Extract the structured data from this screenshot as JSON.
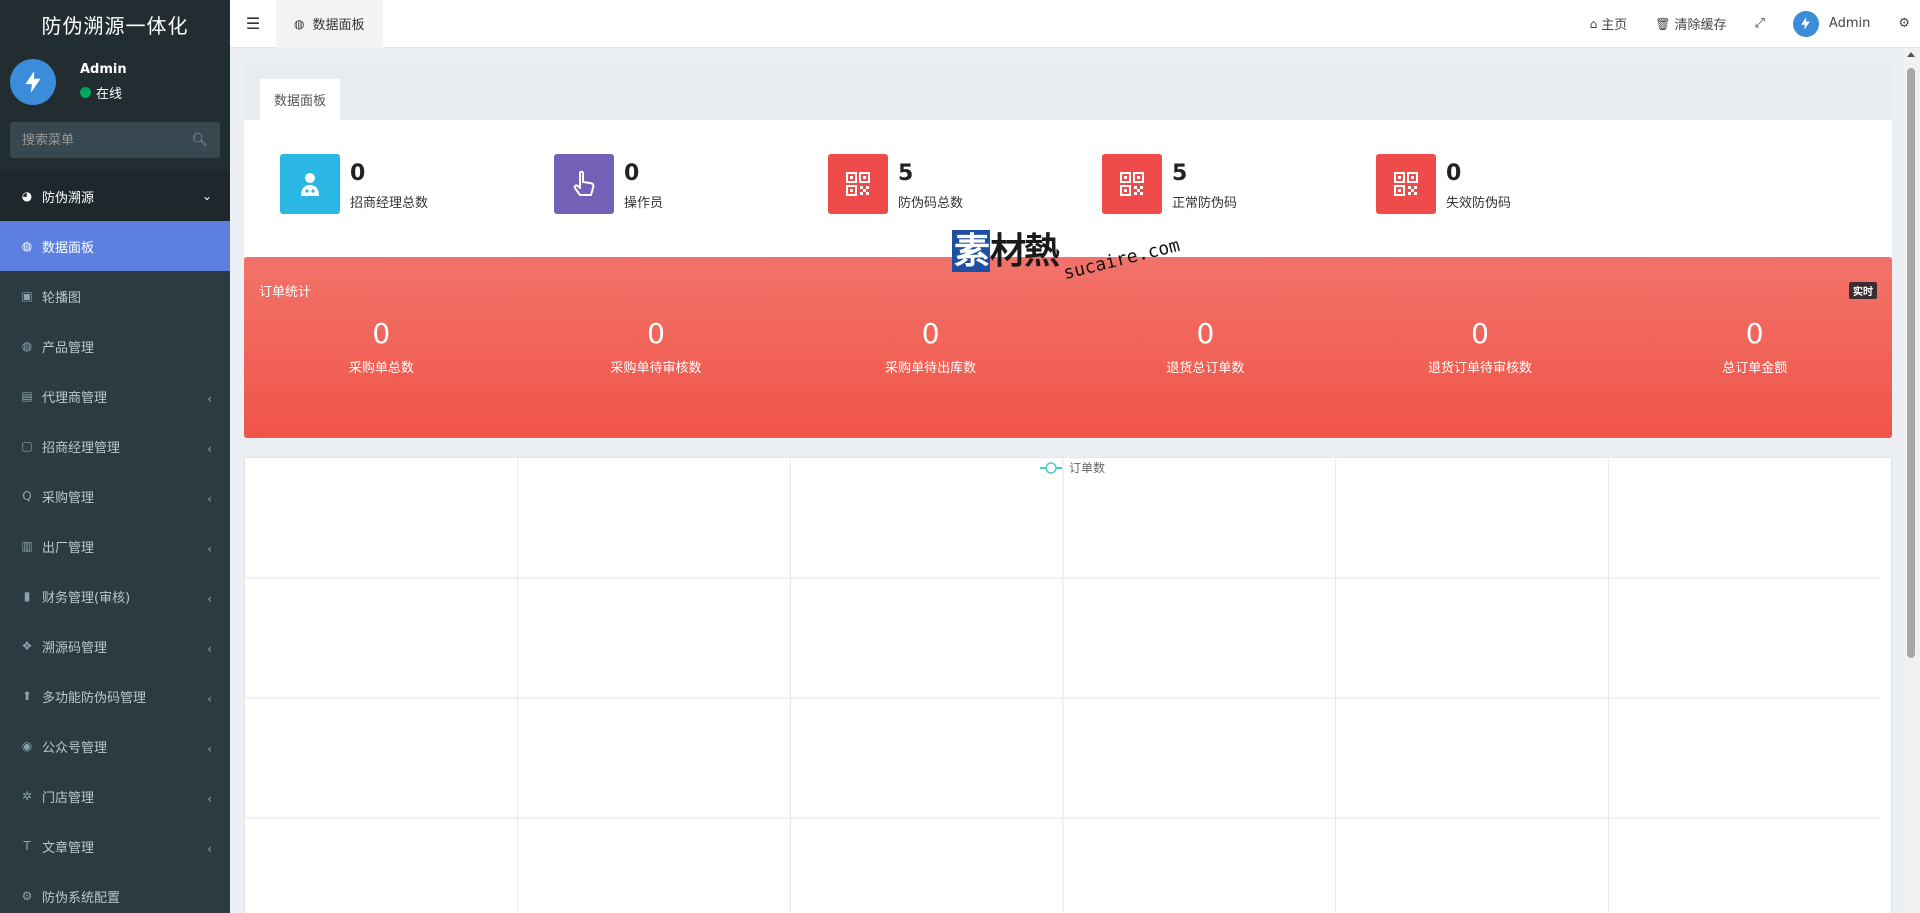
{
  "sidebar": {
    "logo": "防伪溯源一体化",
    "user": {
      "name": "Admin",
      "status": "在线"
    },
    "search_placeholder": "搜索菜单",
    "group": {
      "label": "防伪溯源",
      "icon": "pie-chart-icon"
    },
    "items": [
      {
        "label": "数据面板",
        "icon": "globe-icon",
        "active": true,
        "has_children": false
      },
      {
        "label": "轮播图",
        "icon": "image-icon",
        "active": false,
        "has_children": false
      },
      {
        "label": "产品管理",
        "icon": "globe-icon",
        "active": false,
        "has_children": false
      },
      {
        "label": "代理商管理",
        "icon": "id-card-icon",
        "active": false,
        "has_children": true
      },
      {
        "label": "招商经理管理",
        "icon": "contact-icon",
        "active": false,
        "has_children": true
      },
      {
        "label": "采购管理",
        "icon": "search-q-icon",
        "active": false,
        "has_children": true
      },
      {
        "label": "出厂管理",
        "icon": "truck-icon",
        "active": false,
        "has_children": true
      },
      {
        "label": "财务管理(审核)",
        "icon": "book-icon",
        "active": false,
        "has_children": true
      },
      {
        "label": "溯源码管理",
        "icon": "cubes-icon",
        "active": false,
        "has_children": true
      },
      {
        "label": "多功能防伪码管理",
        "icon": "upload-circle-icon",
        "active": false,
        "has_children": true
      },
      {
        "label": "公众号管理",
        "icon": "wechat-icon",
        "active": false,
        "has_children": true
      },
      {
        "label": "门店管理",
        "icon": "gear-circle-icon",
        "active": false,
        "has_children": true
      },
      {
        "label": "文章管理",
        "icon": "text-icon",
        "active": false,
        "has_children": true
      },
      {
        "label": "防伪系统配置",
        "icon": "gear-icon",
        "active": false,
        "has_children": false
      }
    ]
  },
  "navbar": {
    "tab_label": "数据面板",
    "home": "主页",
    "clear_cache": "清除缓存",
    "user": "Admin"
  },
  "content": {
    "tab_label": "数据面板",
    "stats": [
      {
        "value": "0",
        "label": "招商经理总数",
        "color": "#2ab7e3",
        "icon": "user-doctor-icon"
      },
      {
        "value": "0",
        "label": "操作员",
        "color": "#7460b6",
        "icon": "hand-pointer-icon"
      },
      {
        "value": "5",
        "label": "防伪码总数",
        "color": "#ef4b4b",
        "icon": "qrcode-icon"
      },
      {
        "value": "5",
        "label": "正常防伪码",
        "color": "#ef4b4b",
        "icon": "qrcode-icon"
      },
      {
        "value": "0",
        "label": "失效防伪码",
        "color": "#ef4b4b",
        "icon": "qrcode-icon"
      }
    ],
    "order": {
      "title": "订单统计",
      "badge": "实时",
      "items": [
        {
          "value": "0",
          "label": "采购单总数"
        },
        {
          "value": "0",
          "label": "采购单待审核数"
        },
        {
          "value": "0",
          "label": "采购单待出库数"
        },
        {
          "value": "0",
          "label": "退货总订单数"
        },
        {
          "value": "0",
          "label": "退货订单待审核数"
        },
        {
          "value": "0",
          "label": "总订单金额"
        }
      ]
    },
    "watermark": {
      "main": "素材熱",
      "sub": "sucaire.com"
    }
  },
  "chart_data": {
    "type": "line",
    "series": [
      {
        "name": "订单数",
        "values": []
      }
    ],
    "categories": [],
    "legend": "top-center",
    "grid": true,
    "colors": {
      "series": "#4ecdc4"
    }
  }
}
